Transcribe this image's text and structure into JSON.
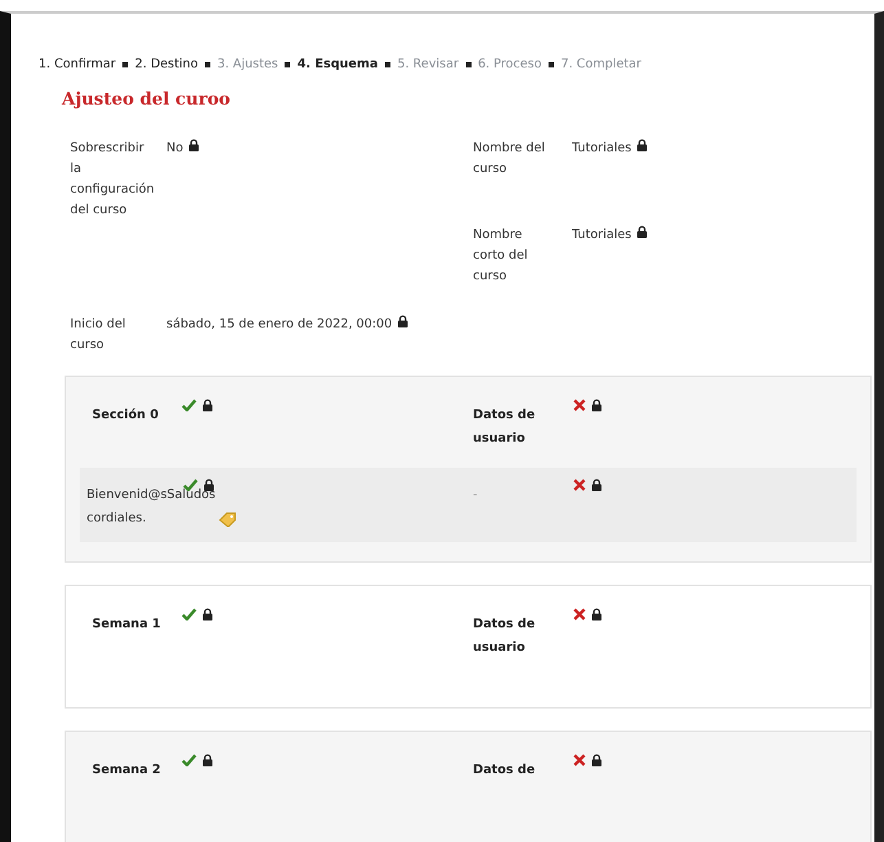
{
  "steps": [
    {
      "label": "1. Confirmar",
      "selected": false,
      "disabled": false
    },
    {
      "label": "2. Destino",
      "selected": false,
      "disabled": false
    },
    {
      "label": "3. Ajustes",
      "selected": false,
      "disabled": true
    },
    {
      "label": "4. Esquema",
      "selected": true,
      "disabled": false
    },
    {
      "label": "5. Revisar",
      "selected": false,
      "disabled": true
    },
    {
      "label": "6. Proceso",
      "selected": false,
      "disabled": true
    },
    {
      "label": "7. Completar",
      "selected": false,
      "disabled": true
    }
  ],
  "title": "Ajusteo del curoo",
  "settings": [
    {
      "label": "Sobrescribir la configuración del curso",
      "value": "No",
      "locked": true
    },
    {
      "label": "Nombre del curso",
      "value": "Tutoriales",
      "locked": true
    },
    {
      "label": "Nombre corto del curso",
      "value": "Tutoriales",
      "locked": true
    },
    {
      "label": "Inicio del curso",
      "value": "sábado, 15 de enero de 2022, 00:00",
      "locked": true
    }
  ],
  "sections": [
    {
      "title": "Sección 0",
      "included": true,
      "locked": true,
      "userdata_label": "Datos de usuario",
      "userdata": false,
      "userdata_locked": true,
      "activities": [
        {
          "title": "Bienvenid@sSaludos cordiales.",
          "included": true,
          "locked": true,
          "userdata_label": "-",
          "userdata": false,
          "userdata_locked": true
        }
      ]
    },
    {
      "title": "Semana 1",
      "included": true,
      "locked": true,
      "userdata_label": "Datos de usuario",
      "userdata": false,
      "userdata_locked": true
    },
    {
      "title": "Semana 2",
      "included": true,
      "locked": true,
      "userdata_label": "Datos de",
      "userdata": false,
      "userdata_locked": true
    }
  ]
}
